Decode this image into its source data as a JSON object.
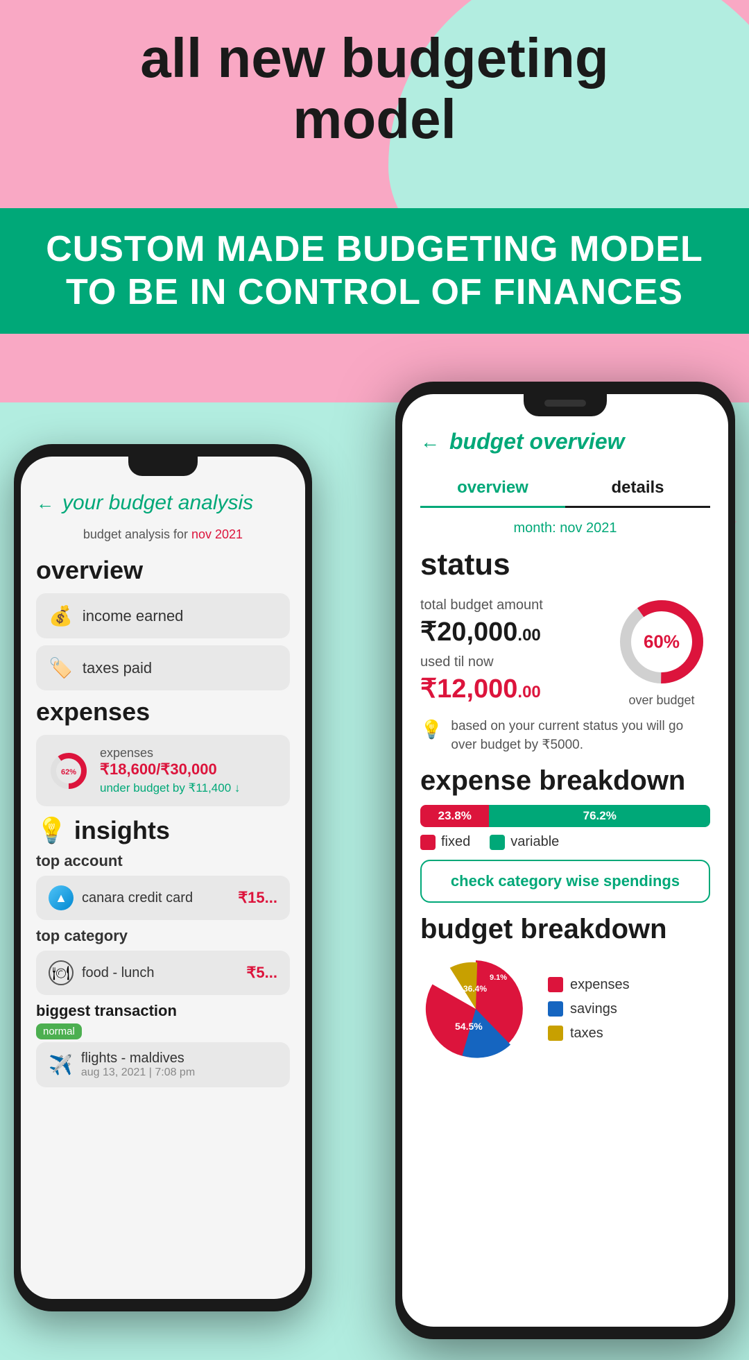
{
  "header": {
    "title_line1": "all new budgeting",
    "title_line2": "model"
  },
  "banner": {
    "line1": "CUSTOM MADE BUDGETING MODEL",
    "line2": "TO BE IN CONTROL OF FINANCES"
  },
  "phone_left": {
    "header": {
      "back_label": "←",
      "title": "your budget analysis"
    },
    "subtitle": "budget analysis for nov 2021",
    "overview_title": "overview",
    "income_item": {
      "icon": "💰",
      "label": "income earned"
    },
    "taxes_item": {
      "icon": "🏷",
      "label": "taxes paid"
    },
    "expenses_title": "expenses",
    "expenses_item": {
      "percent": "62%",
      "label": "expenses",
      "amount": "₹18,600/₹30,000",
      "under": "under budget by ₹11,400 ↓"
    },
    "insights_title": "insights",
    "top_account_label": "top account",
    "account_item": {
      "name": "canara credit card",
      "amount": "₹15..."
    },
    "top_category_label": "top category",
    "category_item": {
      "name": "food - lunch",
      "amount": "₹5..."
    },
    "biggest_transaction_label": "biggest transaction",
    "transaction_item": {
      "badge": "normal",
      "name": "flights - maldives",
      "date": "aug 13, 2021 | 7:08 pm"
    }
  },
  "phone_right": {
    "header": {
      "back_label": "←",
      "title": "budget overview"
    },
    "tabs": [
      {
        "label": "overview",
        "active": true
      },
      {
        "label": "details",
        "active": false
      }
    ],
    "month_label": "month: nov 2021",
    "status_section": {
      "title": "status",
      "total_budget_label": "total budget amount",
      "total_budget_amount": "₹20,000",
      "total_budget_paisa": ".00",
      "used_label": "used til now",
      "used_amount": "₹12,000",
      "used_paisa": ".00",
      "donut_percent": "60%",
      "over_budget_label": "over budget",
      "donut_fixed_pct": 60,
      "donut_gray_pct": 40
    },
    "insight_text": "based on your current status you will go over budget by ₹5000.",
    "expense_breakdown": {
      "title": "expense breakdown",
      "fixed_pct": 23.8,
      "variable_pct": 76.2,
      "fixed_label": "23.8%",
      "variable_label": "76.2%",
      "legend_fixed": "fixed",
      "legend_variable": "variable",
      "check_btn_label": "check category wise spendings"
    },
    "budget_breakdown": {
      "title": "budget breakdown",
      "expenses_pct": 54.5,
      "savings_pct": 36.4,
      "taxes_pct": 9.1,
      "expenses_label": "54.5%",
      "savings_label": "36.4%",
      "taxes_label": "9.1%",
      "legend": [
        {
          "label": "expenses",
          "color": "#dc143c"
        },
        {
          "label": "savings",
          "color": "#1565c0"
        },
        {
          "label": "taxes",
          "color": "#c8a000"
        }
      ]
    }
  },
  "colors": {
    "primary": "#00a878",
    "danger": "#dc143c",
    "dark": "#1a1a1a",
    "pink_bg": "#f9a8c4",
    "mint_bg": "#b2ede0"
  }
}
